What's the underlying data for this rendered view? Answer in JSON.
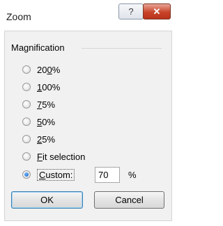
{
  "dialog": {
    "title": "Zoom",
    "help_label": "?",
    "close_label": "✕"
  },
  "magnification": {
    "group_label": "Magnification",
    "options": [
      {
        "pre": "20",
        "mnemonic": "0",
        "post": "%",
        "checked": false
      },
      {
        "pre": "",
        "mnemonic": "1",
        "post": "00%",
        "checked": false
      },
      {
        "pre": "",
        "mnemonic": "7",
        "post": "5%",
        "checked": false
      },
      {
        "pre": "",
        "mnemonic": "5",
        "post": "0%",
        "checked": false
      },
      {
        "pre": "",
        "mnemonic": "2",
        "post": "5%",
        "checked": false
      },
      {
        "pre": "",
        "mnemonic": "F",
        "post": "it selection",
        "checked": false
      },
      {
        "pre": "",
        "mnemonic": "C",
        "post": "ustom:",
        "checked": true
      }
    ],
    "custom_value": "70",
    "percent_sign": "%"
  },
  "buttons": {
    "ok": "OK",
    "cancel": "Cancel"
  }
}
